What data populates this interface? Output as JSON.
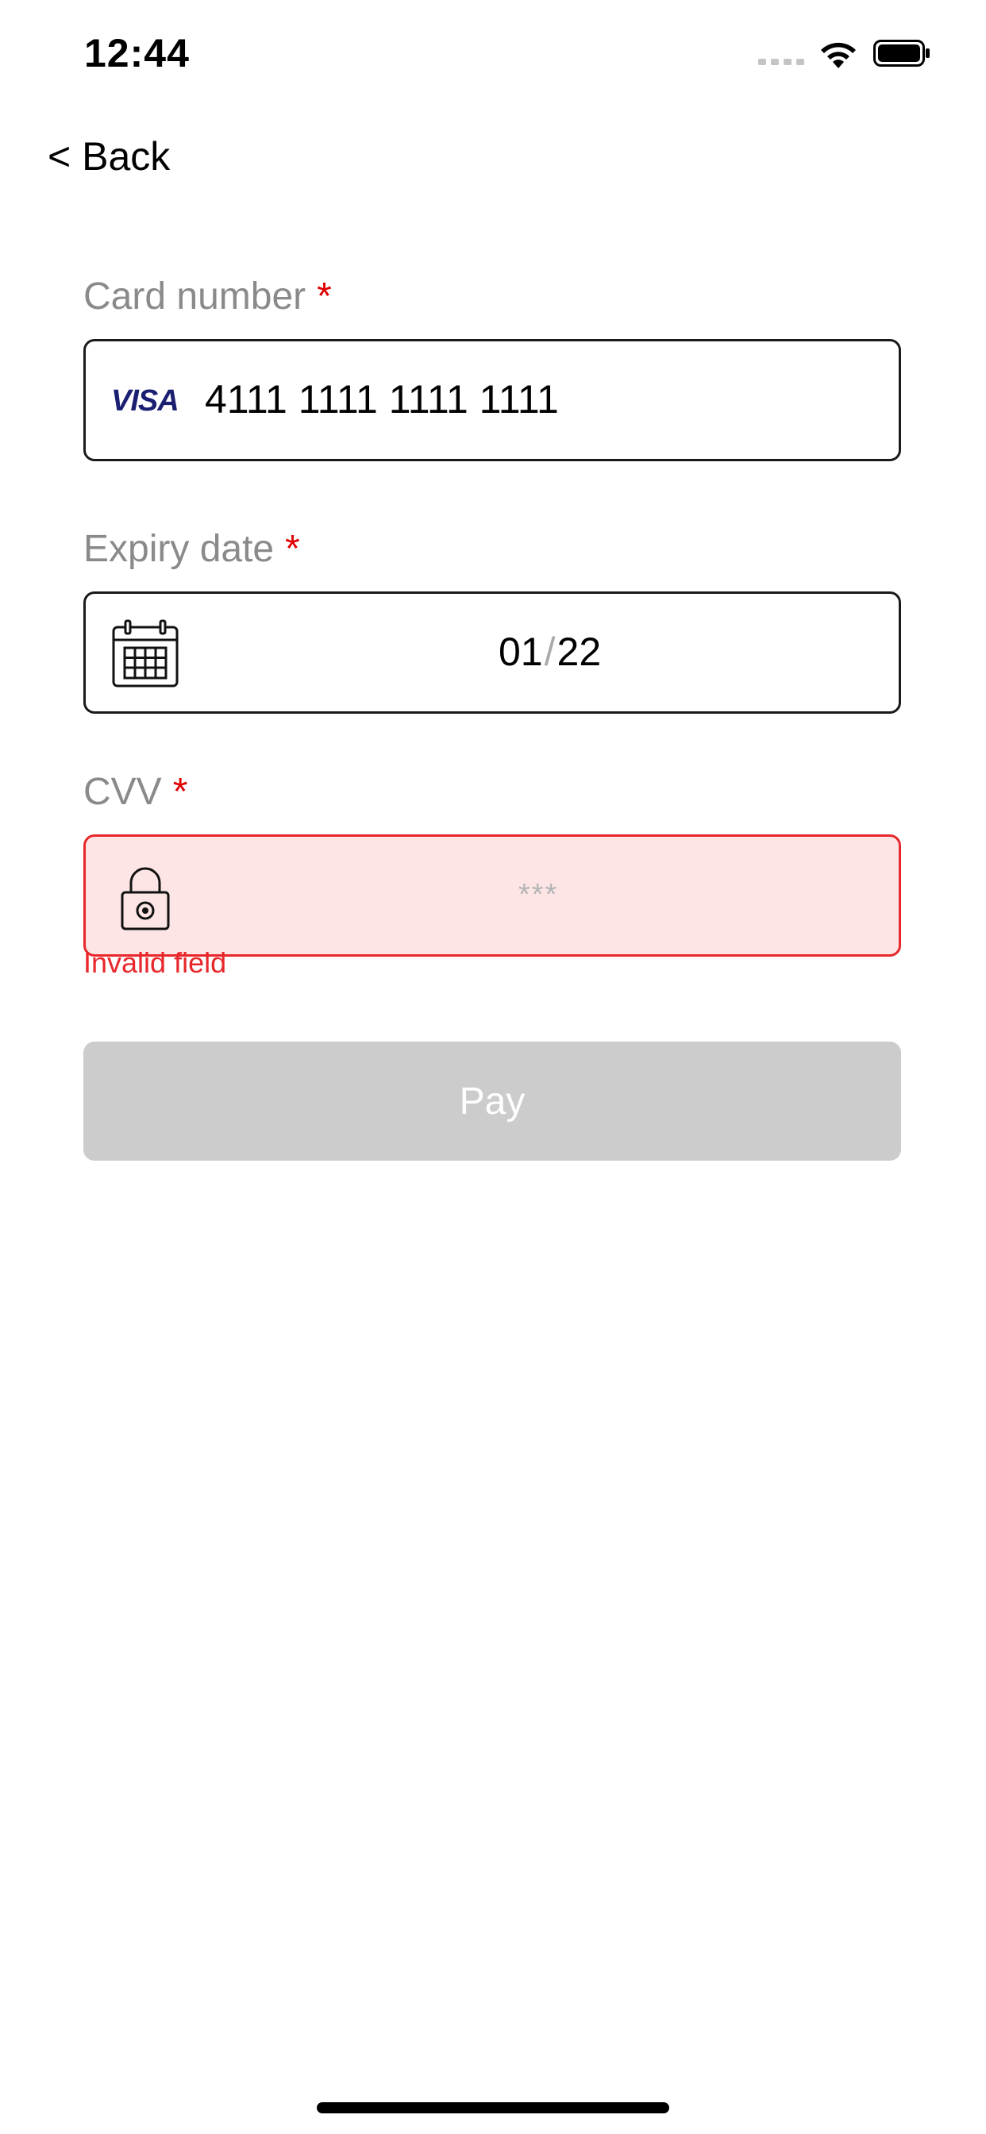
{
  "status_bar": {
    "time": "12:44"
  },
  "nav": {
    "back_label": "< Back"
  },
  "form": {
    "card_number": {
      "label": "Card number",
      "required_mark": "*",
      "brand": "VISA",
      "value": "4111 1111 1111 1111"
    },
    "expiry": {
      "label": "Expiry date",
      "required_mark": "*",
      "month": "01",
      "separator": "/",
      "year": "22"
    },
    "cvv": {
      "label": "CVV",
      "required_mark": "*",
      "placeholder": "***",
      "error": "Invalid field"
    },
    "pay_button": {
      "label": "Pay",
      "enabled": false
    }
  },
  "colors": {
    "error": "#e8272b",
    "error_background": "#fde5e5",
    "required": "#e00000",
    "label": "#8a8a8a",
    "button_disabled": "#cccccc",
    "visa_blue": "#1a1f71"
  },
  "icons": {
    "card_brand": "visa-logo",
    "expiry": "calendar-icon",
    "cvv": "lock-icon",
    "wifi": "wifi-icon",
    "battery": "battery-icon",
    "signal": "signal-icon"
  }
}
